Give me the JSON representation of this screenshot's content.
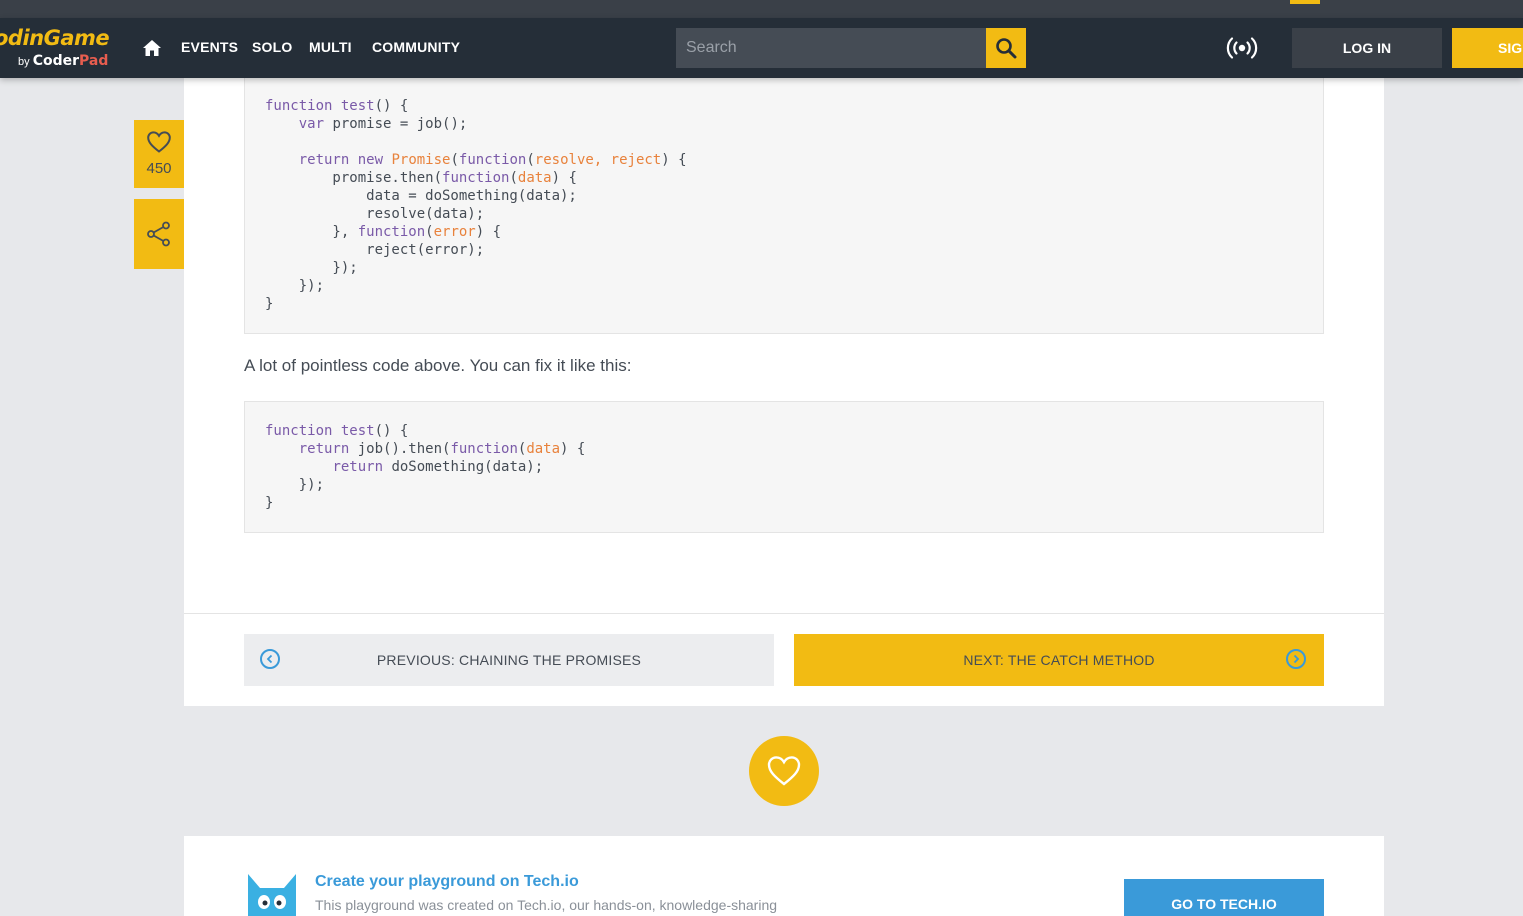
{
  "nav": {
    "logo_text": "odinGame",
    "logo_by": "by",
    "logo_coder": "Coder",
    "logo_pad": "Pad",
    "items": [
      "EVENTS",
      "SOLO",
      "MULTI",
      "COMMUNITY"
    ],
    "search_placeholder": "Search",
    "login": "LOG IN",
    "signup": "SIGN"
  },
  "sidebar": {
    "likes": "450"
  },
  "content": {
    "code1": [
      [
        {
          "t": "function",
          "c": "k"
        },
        {
          "t": " "
        },
        {
          "t": "test",
          "c": "k"
        },
        {
          "t": "() {"
        }
      ],
      [
        {
          "t": "    "
        },
        {
          "t": "var",
          "c": "k"
        },
        {
          "t": " promise = job();"
        }
      ],
      [
        {
          "t": ""
        }
      ],
      [
        {
          "t": "    "
        },
        {
          "t": "return",
          "c": "k"
        },
        {
          "t": " "
        },
        {
          "t": "new",
          "c": "k"
        },
        {
          "t": " "
        },
        {
          "t": "Promise",
          "c": "o"
        },
        {
          "t": "("
        },
        {
          "t": "function",
          "c": "k"
        },
        {
          "t": "("
        },
        {
          "t": "resolve, reject",
          "c": "o"
        },
        {
          "t": ") {"
        }
      ],
      [
        {
          "t": "        promise.then("
        },
        {
          "t": "function",
          "c": "k"
        },
        {
          "t": "("
        },
        {
          "t": "data",
          "c": "o"
        },
        {
          "t": ") {"
        }
      ],
      [
        {
          "t": "            data = doSomething(data);"
        }
      ],
      [
        {
          "t": "            resolve(data);"
        }
      ],
      [
        {
          "t": "        }, "
        },
        {
          "t": "function",
          "c": "k"
        },
        {
          "t": "("
        },
        {
          "t": "error",
          "c": "o"
        },
        {
          "t": ") {"
        }
      ],
      [
        {
          "t": "            reject(error);"
        }
      ],
      [
        {
          "t": "        });"
        }
      ],
      [
        {
          "t": "    });"
        }
      ],
      [
        {
          "t": "}"
        }
      ]
    ],
    "paragraph": "A lot of pointless code above. You can fix it like this:",
    "code2": [
      [
        {
          "t": "function",
          "c": "k"
        },
        {
          "t": " "
        },
        {
          "t": "test",
          "c": "k"
        },
        {
          "t": "() {"
        }
      ],
      [
        {
          "t": "    "
        },
        {
          "t": "return",
          "c": "k"
        },
        {
          "t": " job().then("
        },
        {
          "t": "function",
          "c": "k"
        },
        {
          "t": "("
        },
        {
          "t": "data",
          "c": "o"
        },
        {
          "t": ") {"
        }
      ],
      [
        {
          "t": "        "
        },
        {
          "t": "return",
          "c": "k"
        },
        {
          "t": " doSomething(data);"
        }
      ],
      [
        {
          "t": "    });"
        }
      ],
      [
        {
          "t": "}"
        }
      ]
    ],
    "prev_label": "PREVIOUS: CHAINING THE PROMISES",
    "next_label": "NEXT: THE CATCH METHOD"
  },
  "footer": {
    "title": "Create your playground on Tech.io",
    "description": "This playground was created on Tech.io, our hands-on, knowledge-sharing",
    "button": "GO TO TECH.IO"
  },
  "colors": {
    "accent": "#f2bb13",
    "navbar": "#252e38",
    "link_blue": "#3a9ad9",
    "code_keyword": "#7a5aa8",
    "code_param": "#e8823c"
  }
}
